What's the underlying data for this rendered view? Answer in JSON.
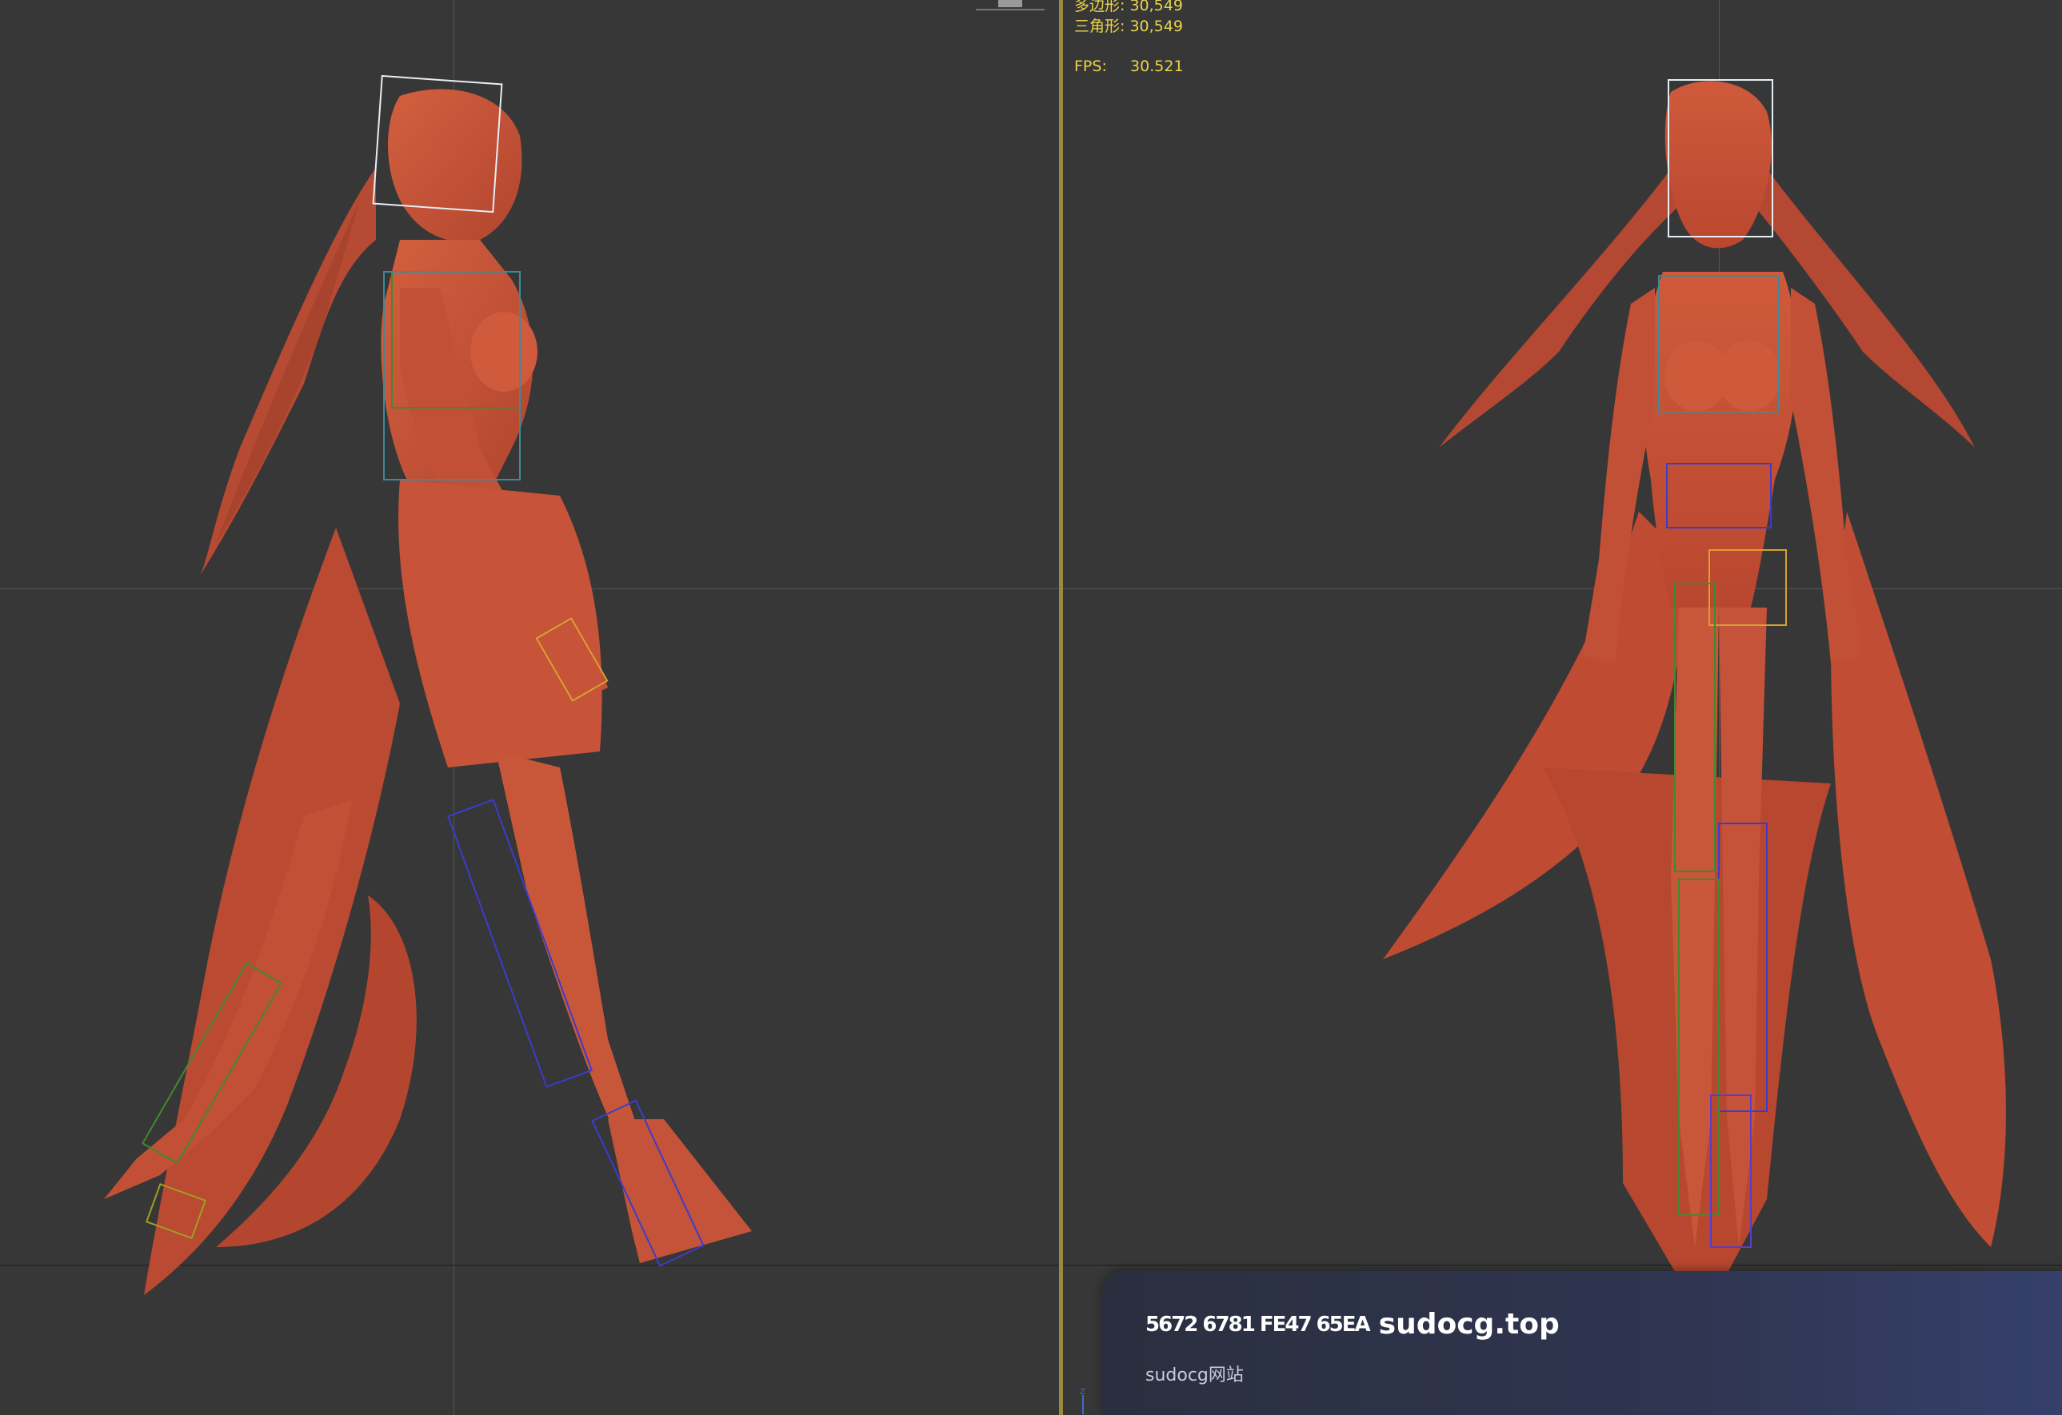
{
  "viewport_stats": {
    "polygons_label": "多边形:",
    "polygons_value": "30,549",
    "triangles_label": "三角形:",
    "triangles_value": "30,549",
    "fps_label": "FPS:",
    "fps_value": "30.521"
  },
  "notification": {
    "glyphs": "5672 6781 FE47 65EA",
    "title": "sudocg.top",
    "body": "sudocg网站"
  },
  "colors": {
    "viewport_bg": "#373737",
    "model": "#c4533a",
    "stats_text": "#e9d44a",
    "active_border": "#9c8a3c",
    "bone_blue": "#3c3ccc",
    "bone_green": "#3f8a2c",
    "selection_white": "#e6eef5",
    "selection_orange": "#d8a030"
  },
  "icons": {
    "notification": "app-badge-icon",
    "axis": "axis-tripod-icon"
  }
}
